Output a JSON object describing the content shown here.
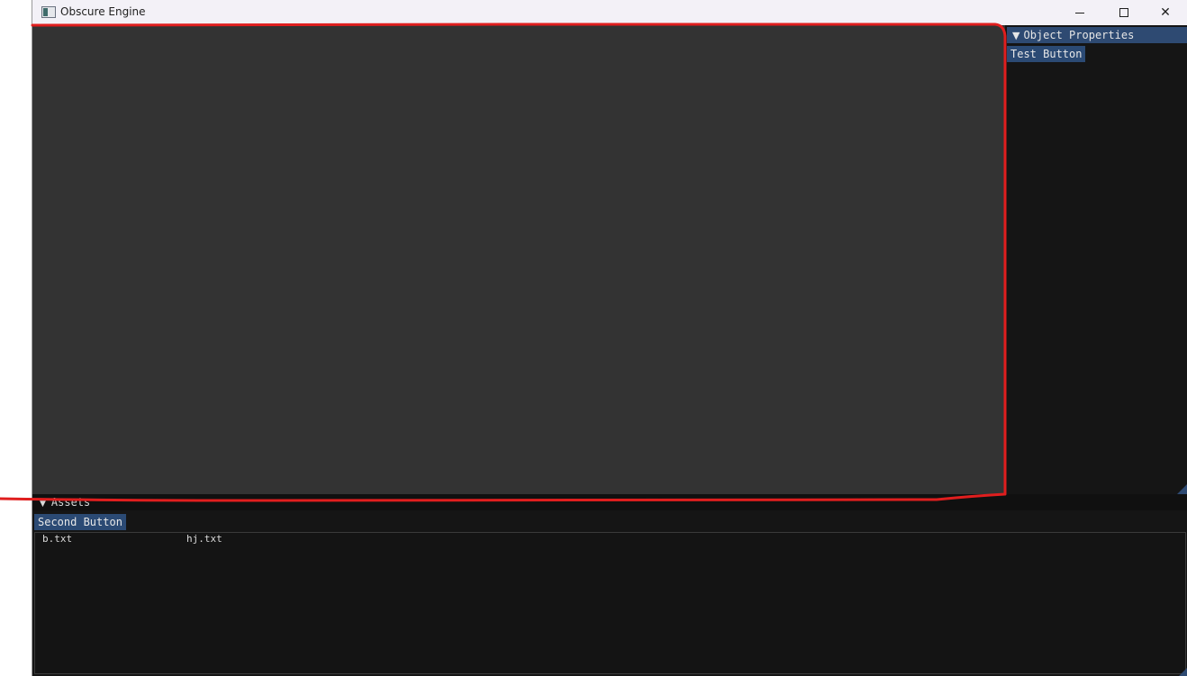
{
  "window": {
    "title": "Obscure Engine",
    "controls": {
      "minimize": "minimize-icon",
      "maximize": "maximize-icon",
      "close": "close-icon"
    }
  },
  "properties_panel": {
    "title": "Object Properties",
    "button_label": "Test Button"
  },
  "assets_panel": {
    "title": "Assets",
    "button_label": "Second Button",
    "files": [
      "b.txt",
      "hj.txt"
    ]
  },
  "colors": {
    "viewport": "#333333",
    "panel": "#151515",
    "header_accent": "#2e4a72",
    "button": "#2b4a74",
    "annotation": "#e01e1e"
  }
}
